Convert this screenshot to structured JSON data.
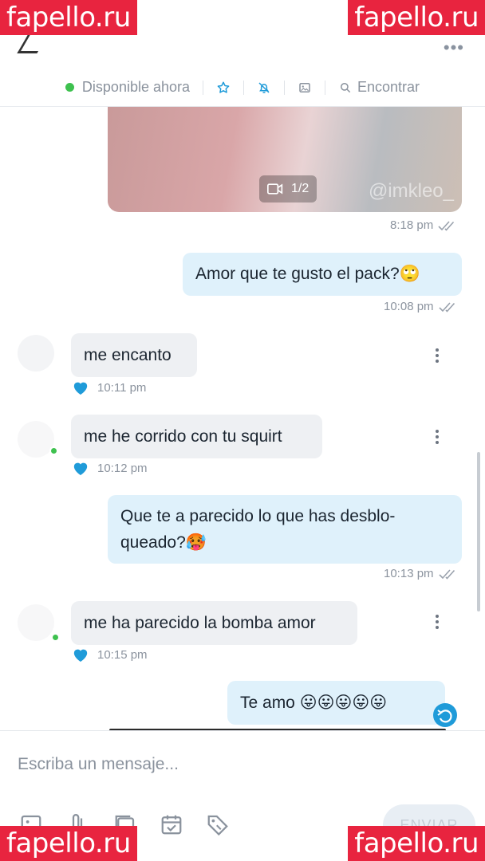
{
  "watermark": "fapello.ru",
  "header": {
    "status_label": "Disponible ahora",
    "search_label": "Encontrar"
  },
  "media": {
    "counter": "1/2",
    "handle": "@imkleo_",
    "time": "8:18 pm"
  },
  "messages": [
    {
      "id": "m1",
      "direction": "out",
      "text": "Amor que te gusto el pack?🙄",
      "time": "10:08 pm"
    },
    {
      "id": "m2",
      "direction": "in",
      "text": "me encanto",
      "time": "10:11 pm"
    },
    {
      "id": "m3",
      "direction": "in",
      "text": "me he corrido con tu squirt",
      "time": "10:12 pm"
    },
    {
      "id": "m4",
      "direction": "out",
      "text_line1": "Que te a parecido lo que has desblo-",
      "text_line2": "queado?🥵",
      "time": "10:13 pm"
    },
    {
      "id": "m5",
      "direction": "in",
      "text": "me ha parecido la bomba amor",
      "time": "10:15 pm"
    },
    {
      "id": "m6",
      "direction": "out",
      "text": "Te amo 😛😛😛😛😛"
    }
  ],
  "composer": {
    "placeholder": "Escriba un mensaje...",
    "send_label": "ENVIAR"
  },
  "colors": {
    "online": "#3ec14f",
    "accent": "#1f9bd9",
    "outgoing_bubble": "#dff1fb",
    "incoming_bubble": "#eef0f3",
    "watermark_bg": "#e8243f"
  },
  "icons": [
    "back-arrow-icon",
    "more-icon",
    "star-icon",
    "bell-off-icon",
    "image-icon",
    "search-icon",
    "video-icon",
    "read-ticks-icon",
    "heart-icon",
    "kebab-icon",
    "reply-icon",
    "media-icon",
    "attach-icon",
    "gallery-icon",
    "calendar-icon",
    "price-tag-icon"
  ]
}
